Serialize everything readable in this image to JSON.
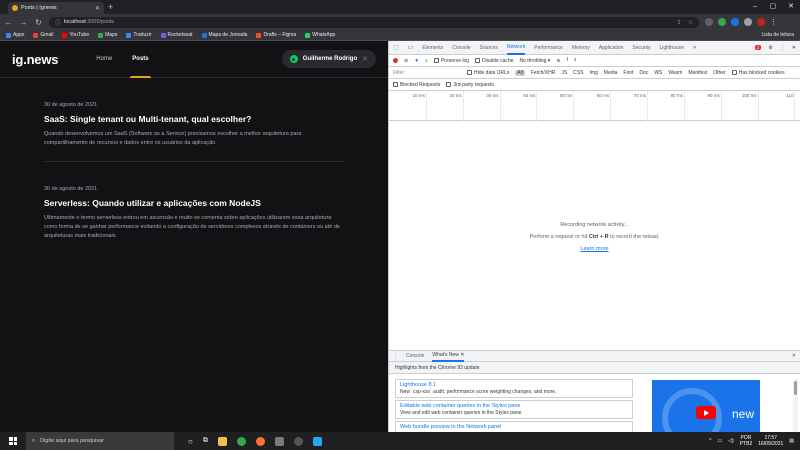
{
  "browser": {
    "tab_title": "Posts | Ignews",
    "url_host": "localhost",
    "url_path": ":3000/posts",
    "bookmarks": [
      {
        "label": "Apps",
        "color": "#4285f4"
      },
      {
        "label": "Gmail",
        "color": "#ea4335"
      },
      {
        "label": "YouTube",
        "color": "#ff0000"
      },
      {
        "label": "Maps",
        "color": "#34a853"
      },
      {
        "label": "Traduzir",
        "color": "#4285f4"
      },
      {
        "label": "Rocketseat",
        "color": "#8257e5"
      },
      {
        "label": "Mapa de Jornada",
        "color": "#1a73e8"
      },
      {
        "label": "Drafts – Figma",
        "color": "#f24e1e"
      },
      {
        "label": "WhatsApp",
        "color": "#25d366"
      }
    ],
    "reading_list": "Lista de leitura"
  },
  "site": {
    "logo": "ig.news",
    "nav": [
      {
        "label": "Home",
        "active": false
      },
      {
        "label": "Posts",
        "active": true
      }
    ],
    "signin_user": "Guilherme Rodrigo",
    "accent_color": "#eba417",
    "posts": [
      {
        "date": "30 de agosto de 2021",
        "title": "SaaS: Single tenant ou Multi-tenant, qual escolher?",
        "excerpt": "Quando desenvolvemos um SaaS (Software as a Service) precisamos escolher a melhor arquitetura para compartilhamento de recursos e dados entre os usuários da aplicação."
      },
      {
        "date": "30 de agosto de 2021",
        "title": "Serverless: Quando utilizar e aplicações com NodeJS",
        "excerpt": "Ultimamente o termo serverless entrou em ascensão e muito se comenta sobre aplicações utilizarem essa arquitetura como forma de se ganhar performance evitando a configuração de servidores complexos através de containers ou até de arquiteturas mais tradicionais."
      }
    ]
  },
  "devtools": {
    "tabs": [
      "Elements",
      "Console",
      "Sources",
      "Network",
      "Performance",
      "Memory",
      "Application",
      "Security",
      "Lighthouse"
    ],
    "active_tab": "Network",
    "error_count": "2",
    "preserve_log": "Preserve log",
    "disable_cache": "Disable cache",
    "throttling": "No throttling",
    "filter_placeholder": "Filter",
    "hide_data_urls": "Hide data URLs",
    "types": [
      "All",
      "Fetch/XHR",
      "JS",
      "CSS",
      "Img",
      "Media",
      "Font",
      "Doc",
      "WS",
      "Wasm",
      "Manifest",
      "Other"
    ],
    "has_blocked_cookies": "Has blocked cookies",
    "blocked_requests": "Blocked Requests",
    "third_party": "3rd-party requests",
    "ticks": [
      "10 ms",
      "20 ms",
      "30 ms",
      "40 ms",
      "50 ms",
      "60 ms",
      "70 ms",
      "80 ms",
      "90 ms",
      "100 ms",
      "110"
    ],
    "recording": "Recording network activity...",
    "hint_pre": "Perform a request or hit ",
    "hint_keys": "Ctrl + R",
    "hint_post": " to record the reload.",
    "learn_more": "Learn more",
    "drawer_tabs": [
      "Console",
      "What's New"
    ],
    "drawer_highlights": "Highlights from the Chrome 93 update",
    "cards": [
      {
        "title": "Lighthouse 8.1",
        "desc": "New `csp-xss` audit, performance score weighting changes, and more."
      },
      {
        "title": "Editable web container queries in the Styles pane",
        "desc": "View and edit web container queries in the Styles pane."
      },
      {
        "title": "Web bundle preview in the Network panel",
        "desc": ""
      }
    ],
    "video_label": "new"
  },
  "taskbar": {
    "search_placeholder": "Digite aqui para pesquisar",
    "lang1": "POR",
    "lang2": "PTB2",
    "time": "17:57",
    "date": "16/09/2021"
  }
}
